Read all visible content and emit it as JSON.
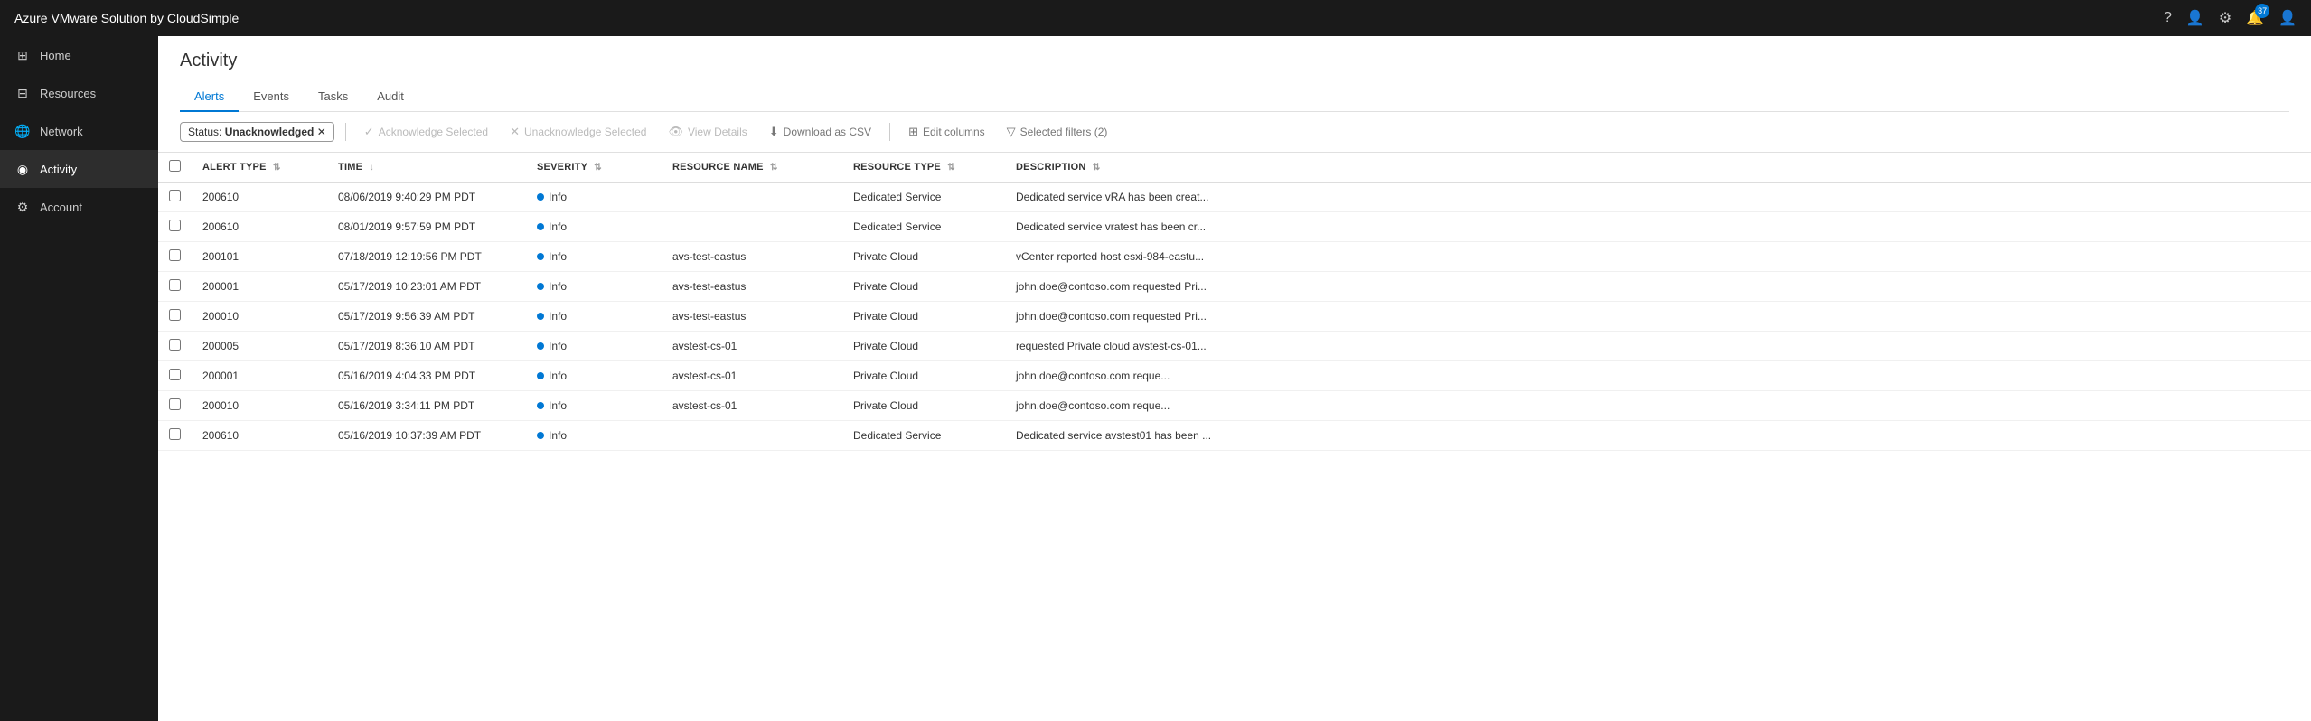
{
  "app": {
    "title": "Azure VMware Solution by CloudSimple"
  },
  "topbar": {
    "title": "Azure VMware Solution by CloudSimple",
    "notification_count": "37"
  },
  "sidebar": {
    "items": [
      {
        "id": "home",
        "label": "Home",
        "icon": "⊞"
      },
      {
        "id": "resources",
        "label": "Resources",
        "icon": "⊟"
      },
      {
        "id": "network",
        "label": "Network",
        "icon": "🌐"
      },
      {
        "id": "activity",
        "label": "Activity",
        "icon": "◉",
        "active": true
      },
      {
        "id": "account",
        "label": "Account",
        "icon": "⚙"
      }
    ]
  },
  "page": {
    "title": "Activity"
  },
  "tabs": [
    {
      "id": "alerts",
      "label": "Alerts",
      "active": true
    },
    {
      "id": "events",
      "label": "Events",
      "active": false
    },
    {
      "id": "tasks",
      "label": "Tasks",
      "active": false
    },
    {
      "id": "audit",
      "label": "Audit",
      "active": false
    }
  ],
  "filter": {
    "label": "Status:",
    "value": "Unacknowledged"
  },
  "toolbar": {
    "acknowledge_label": "Acknowledge Selected",
    "unacknowledge_label": "Unacknowledge Selected",
    "view_details_label": "View Details",
    "download_label": "Download as CSV",
    "edit_columns_label": "Edit columns",
    "selected_filters_label": "Selected filters (2)"
  },
  "table": {
    "headers": [
      {
        "id": "alert_type",
        "label": "ALERT TYPE"
      },
      {
        "id": "time",
        "label": "TIME"
      },
      {
        "id": "severity",
        "label": "SEVERITY"
      },
      {
        "id": "resource_name",
        "label": "RESOURCE NAME"
      },
      {
        "id": "resource_type",
        "label": "RESOURCE TYPE"
      },
      {
        "id": "description",
        "label": "DESCRIPTION"
      }
    ],
    "rows": [
      {
        "alert_type": "200610",
        "time": "08/06/2019 9:40:29 PM PDT",
        "severity": "Info",
        "resource_name": "",
        "resource_type": "Dedicated Service",
        "description": "Dedicated service vRA has been creat..."
      },
      {
        "alert_type": "200610",
        "time": "08/01/2019 9:57:59 PM PDT",
        "severity": "Info",
        "resource_name": "",
        "resource_type": "Dedicated Service",
        "description": "Dedicated service vratest has been cr..."
      },
      {
        "alert_type": "200101",
        "time": "07/18/2019 12:19:56 PM PDT",
        "severity": "Info",
        "resource_name": "avs-test-eastus",
        "resource_type": "Private Cloud",
        "description": "vCenter reported host esxi-984-eastu..."
      },
      {
        "alert_type": "200001",
        "time": "05/17/2019 10:23:01 AM PDT",
        "severity": "Info",
        "resource_name": "avs-test-eastus",
        "resource_type": "Private Cloud",
        "description": "john.doe@contoso.com  requested Pri..."
      },
      {
        "alert_type": "200010",
        "time": "05/17/2019 9:56:39 AM PDT",
        "severity": "Info",
        "resource_name": "avs-test-eastus",
        "resource_type": "Private Cloud",
        "description": "john.doe@contoso.com  requested Pri..."
      },
      {
        "alert_type": "200005",
        "time": "05/17/2019 8:36:10 AM PDT",
        "severity": "Info",
        "resource_name": "avstest-cs-01",
        "resource_type": "Private Cloud",
        "description": "requested Private cloud avstest-cs-01..."
      },
      {
        "alert_type": "200001",
        "time": "05/16/2019 4:04:33 PM PDT",
        "severity": "Info",
        "resource_name": "avstest-cs-01",
        "resource_type": "Private Cloud",
        "description": "john.doe@contoso.com    reque..."
      },
      {
        "alert_type": "200010",
        "time": "05/16/2019 3:34:11 PM PDT",
        "severity": "Info",
        "resource_name": "avstest-cs-01",
        "resource_type": "Private Cloud",
        "description": "john.doe@contoso.com    reque..."
      },
      {
        "alert_type": "200610",
        "time": "05/16/2019 10:37:39 AM PDT",
        "severity": "Info",
        "resource_name": "",
        "resource_type": "Dedicated Service",
        "description": "Dedicated service avstest01 has been ..."
      }
    ]
  }
}
